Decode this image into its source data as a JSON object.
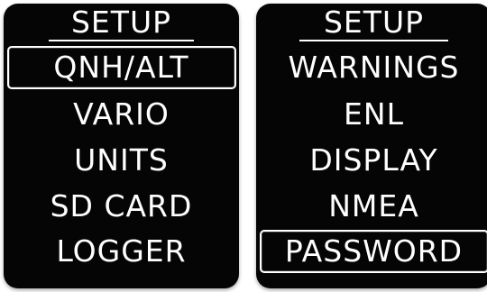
{
  "screens": [
    {
      "title": "SETUP",
      "items": [
        {
          "label": "QNH/ALT",
          "selected": true
        },
        {
          "label": "VARIO",
          "selected": false
        },
        {
          "label": "UNITS",
          "selected": false
        },
        {
          "label": "SD CARD",
          "selected": false
        },
        {
          "label": "LOGGER",
          "selected": false
        }
      ]
    },
    {
      "title": "SETUP",
      "items": [
        {
          "label": "WARNINGS",
          "selected": false
        },
        {
          "label": "ENL",
          "selected": false
        },
        {
          "label": "DISPLAY",
          "selected": false
        },
        {
          "label": "NMEA",
          "selected": false
        },
        {
          "label": "PASSWORD",
          "selected": true
        }
      ]
    }
  ],
  "colors": {
    "screen_background": "#050505",
    "text": "#ffffff",
    "selection_border": "#ffffff"
  }
}
